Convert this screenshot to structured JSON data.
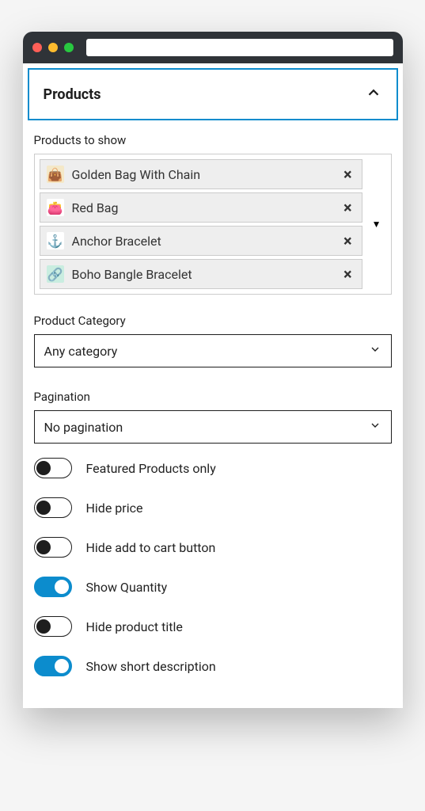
{
  "panel": {
    "title": "Products"
  },
  "productsToShow": {
    "label": "Products to show",
    "items": [
      {
        "name": "Golden Bag With Chain",
        "emoji": "👜",
        "bg": "#f4e8c8"
      },
      {
        "name": "Red Bag",
        "emoji": "👛",
        "bg": "#fff"
      },
      {
        "name": "Anchor Bracelet",
        "emoji": "⚓",
        "bg": "#fff"
      },
      {
        "name": "Boho Bangle Bracelet",
        "emoji": "🔗",
        "bg": "#c9ede0"
      }
    ]
  },
  "category": {
    "label": "Product Category",
    "value": "Any category"
  },
  "pagination": {
    "label": "Pagination",
    "value": "No pagination"
  },
  "toggles": [
    {
      "key": "featured",
      "label": "Featured Products only",
      "on": false
    },
    {
      "key": "hide-price",
      "label": "Hide price",
      "on": false
    },
    {
      "key": "hide-add-to-cart",
      "label": "Hide add to cart button",
      "on": false
    },
    {
      "key": "show-quantity",
      "label": "Show Quantity",
      "on": true
    },
    {
      "key": "hide-title",
      "label": "Hide product title",
      "on": false
    },
    {
      "key": "show-short-desc",
      "label": "Show short description",
      "on": true
    }
  ]
}
